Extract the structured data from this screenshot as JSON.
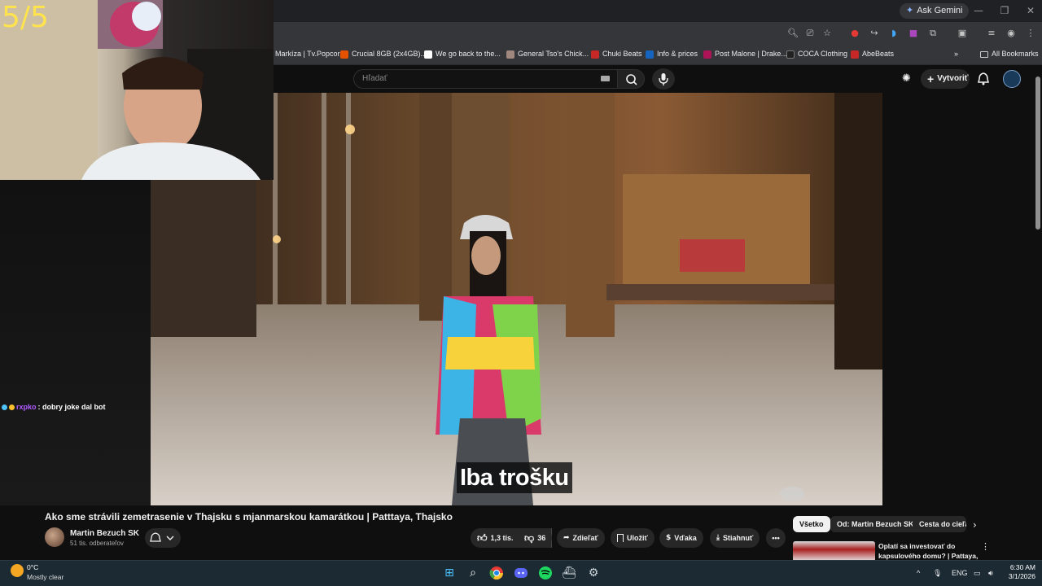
{
  "browser": {
    "ask_gemini": "Ask Gemini",
    "bookmarks": [
      {
        "label": "Markíza | Tv.Popcor...",
        "color": "#e53935"
      },
      {
        "label": "Crucial 8GB (2x4GB)...",
        "color": "#e65100"
      },
      {
        "label": "We go back to the...",
        "color": "#ffffff"
      },
      {
        "label": "General Tso's Chick...",
        "color": "#a1887f"
      },
      {
        "label": "Chuki Beats",
        "color": "#c62828"
      },
      {
        "label": "Info & prices",
        "color": "#1565c0"
      },
      {
        "label": "Post Malone | Drake...",
        "color": "#ad1457"
      },
      {
        "label": "COCA Clothing",
        "color": "#212121"
      },
      {
        "label": "AbeBeats",
        "color": "#c62828"
      }
    ],
    "all_bookmarks": "All Bookmarks"
  },
  "overlay": {
    "counter": "5/5"
  },
  "youtube": {
    "search_placeholder": "Hľadať",
    "create_label": "Vytvoriť",
    "subtitle": "Iba trošku",
    "video_title": "Ako sme strávili zemetrasenie v Thajsku s mjanmarskou kamarátkou | Patttaya, Thajsko",
    "channel_name": "Martin Bezuch SK",
    "channel_subs": "51 tis. odberateľov",
    "like_count": "1,3 tis.",
    "dislike_count": "36",
    "share_label": "Zdieľať",
    "save_label": "Uložiť",
    "thanks_label": "Vďaka",
    "download_label": "Stiahnuť",
    "chips": [
      "Všetko",
      "Od: Martin Bezuch SK",
      "Cesta do cieľa"
    ],
    "rec_title": "Oplatí sa investovať do kapsulového domu? | Pattaya, ..."
  },
  "chat": {
    "user": "rxpko",
    "message": ": dobry joke dal bot"
  },
  "taskbar": {
    "weather_temp": "0°C",
    "weather_desc": "Mostly clear",
    "lang": "ENG",
    "time": "6:30 AM",
    "date": "3/1/2026"
  }
}
